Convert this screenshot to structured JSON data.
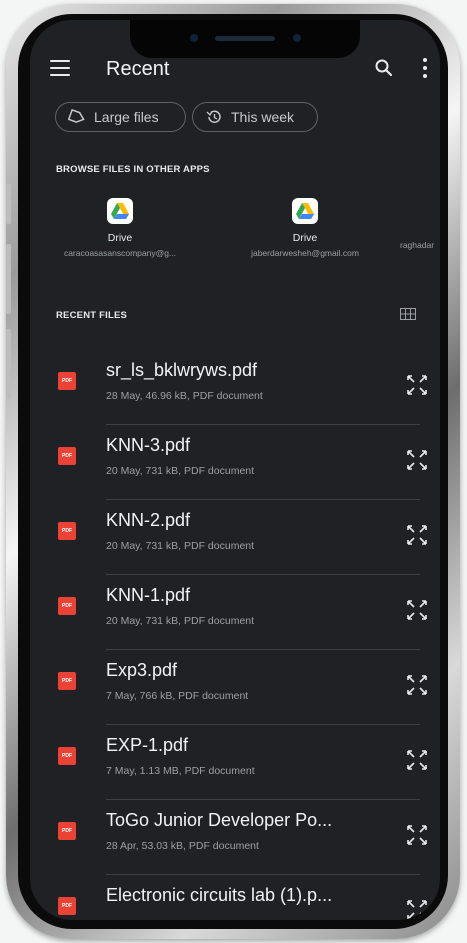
{
  "header": {
    "title": "Recent"
  },
  "filters": [
    {
      "label": "Large files",
      "icon": "tag-icon"
    },
    {
      "label": "This week",
      "icon": "history-icon"
    }
  ],
  "browse_section": {
    "heading": "BROWSE FILES IN OTHER APPS",
    "apps": [
      {
        "name": "Drive",
        "account": "caracoasasanscompany@g...",
        "icon": "google-drive-icon"
      },
      {
        "name": "Drive",
        "account": "jaberdarwesheh@gmail.com",
        "icon": "google-drive-icon"
      },
      {
        "name": "",
        "account": "raghadar"
      }
    ]
  },
  "recent_section": {
    "heading": "RECENT FILES"
  },
  "files": [
    {
      "name": "sr_ls_bklwryws.pdf",
      "meta": "28 May, 46.96 kB, PDF document"
    },
    {
      "name": "KNN-3.pdf",
      "meta": "20 May, 731 kB, PDF document"
    },
    {
      "name": "KNN-2.pdf",
      "meta": "20 May, 731 kB, PDF document"
    },
    {
      "name": "KNN-1.pdf",
      "meta": "20 May, 731 kB, PDF document"
    },
    {
      "name": "Exp3.pdf",
      "meta": "7 May, 766 kB, PDF document"
    },
    {
      "name": "EXP-1.pdf",
      "meta": "7 May, 1.13 MB, PDF document"
    },
    {
      "name": "ToGo Junior Developer Po...",
      "meta": "28 Apr, 53.03 kB, PDF document"
    },
    {
      "name": "Electronic circuits lab (1).p...",
      "meta": ""
    }
  ],
  "pdf_icon_text": "PDF",
  "colors": {
    "background": "#202124",
    "pdf_red": "#ea4335",
    "text": "#e8eaed",
    "secondary_text": "#9aa0a6"
  }
}
